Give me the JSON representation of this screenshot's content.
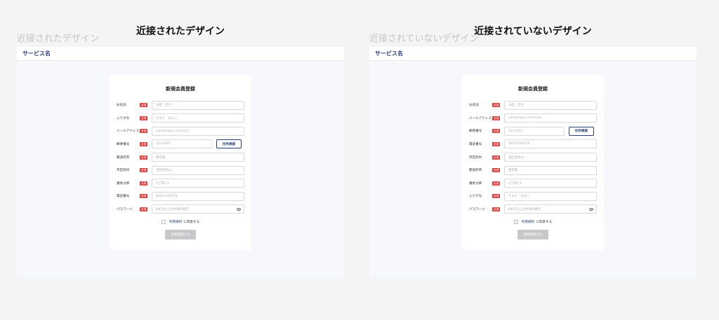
{
  "left": {
    "ghost_label": "近接されたデザイン",
    "heading": "近接されたデザイン",
    "service_name": "サービス名",
    "form_title": "新規会員登録",
    "address_button": "住所検索",
    "required_badge": "必須",
    "fields": [
      {
        "label": "お名前",
        "placeholder": "山田　花子"
      },
      {
        "label": "ふりがな",
        "placeholder": "やまだ　はなこ"
      },
      {
        "label": "メールアドレス",
        "placeholder": "sample@ex-mail.com"
      },
      {
        "label": "郵便番号",
        "placeholder": "123-4567"
      },
      {
        "label": "都道府県",
        "placeholder": "東京都"
      },
      {
        "label": "市区町村",
        "placeholder": "港区南青山"
      },
      {
        "label": "番地以降",
        "placeholder": "1丁目1-1"
      },
      {
        "label": "電話番号",
        "placeholder": "09012345678"
      },
      {
        "label": "パスワード",
        "placeholder": "8文字以上の半角英数字"
      }
    ],
    "terms_link": "利用規約",
    "agree_text": "に同意する",
    "submit_label": "会員登録する"
  },
  "right": {
    "ghost_label": "近接されていないデザイン",
    "heading": "近接されていないデザイン",
    "service_name": "サービス名",
    "form_title": "新規会員登録",
    "address_button": "住所検索",
    "required_badge": "必須",
    "fields": [
      {
        "label": "お名前",
        "placeholder": "山田　花子"
      },
      {
        "label": "メールアドレス",
        "placeholder": "sample@ex-mail.com"
      },
      {
        "label": "郵便番号",
        "placeholder": "123-4567"
      },
      {
        "label": "電話番号",
        "placeholder": "09012345678"
      },
      {
        "label": "市区町村",
        "placeholder": "港区南青山"
      },
      {
        "label": "都道府県",
        "placeholder": "東京都"
      },
      {
        "label": "番地以降",
        "placeholder": "1丁目1-1"
      },
      {
        "label": "ふりがな",
        "placeholder": "やまだ　はなこ"
      },
      {
        "label": "パスワード",
        "placeholder": "8文字以上の半角英数字"
      }
    ],
    "terms_link": "利用規約",
    "agree_text": "に同意する",
    "submit_label": "会員登録する"
  }
}
